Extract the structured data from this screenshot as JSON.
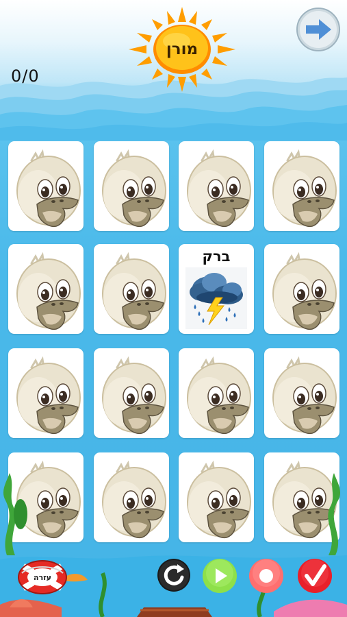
{
  "header": {
    "sun_label": "מורן",
    "score": "0/0"
  },
  "cards": [
    {
      "state": "hidden",
      "icon": "duck-icon"
    },
    {
      "state": "hidden",
      "icon": "duck-icon"
    },
    {
      "state": "hidden",
      "icon": "duck-icon"
    },
    {
      "state": "hidden",
      "icon": "duck-icon"
    },
    {
      "state": "hidden",
      "icon": "duck-icon"
    },
    {
      "state": "hidden",
      "icon": "duck-icon"
    },
    {
      "state": "revealed",
      "word": "ברק",
      "icon": "storm-cloud-lightning-icon"
    },
    {
      "state": "hidden",
      "icon": "duck-icon"
    },
    {
      "state": "hidden",
      "icon": "duck-icon"
    },
    {
      "state": "hidden",
      "icon": "duck-icon"
    },
    {
      "state": "hidden",
      "icon": "duck-icon"
    },
    {
      "state": "hidden",
      "icon": "duck-icon"
    },
    {
      "state": "hidden",
      "icon": "duck-icon"
    },
    {
      "state": "hidden",
      "icon": "duck-icon"
    },
    {
      "state": "hidden",
      "icon": "duck-icon"
    },
    {
      "state": "hidden",
      "icon": "duck-icon"
    }
  ],
  "toolbar": {
    "help_label": "עזרה"
  },
  "colors": {
    "water": "#4ab9ea",
    "sun": "#ffb300",
    "play": "#8ee04a",
    "record": "#ff6f6f",
    "check": "#e8202a"
  }
}
